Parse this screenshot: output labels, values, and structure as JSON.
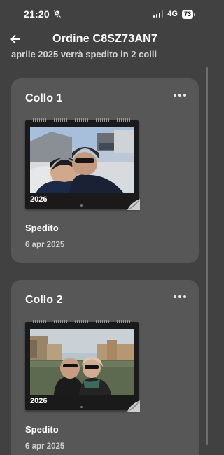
{
  "status_bar": {
    "time": "21:20",
    "network": "4G",
    "battery": "73"
  },
  "header": {
    "title": "Ordine C8SZ73AN7"
  },
  "subtitle": "aprile 2025 verrà spedito in 2 colli",
  "packages": [
    {
      "title": "Collo 1",
      "calendar_year": "2026",
      "status": "Spedito",
      "date": "6 apr 2025"
    },
    {
      "title": "Collo 2",
      "calendar_year": "2026",
      "status": "Spedito",
      "date": "6 apr 2025"
    }
  ]
}
